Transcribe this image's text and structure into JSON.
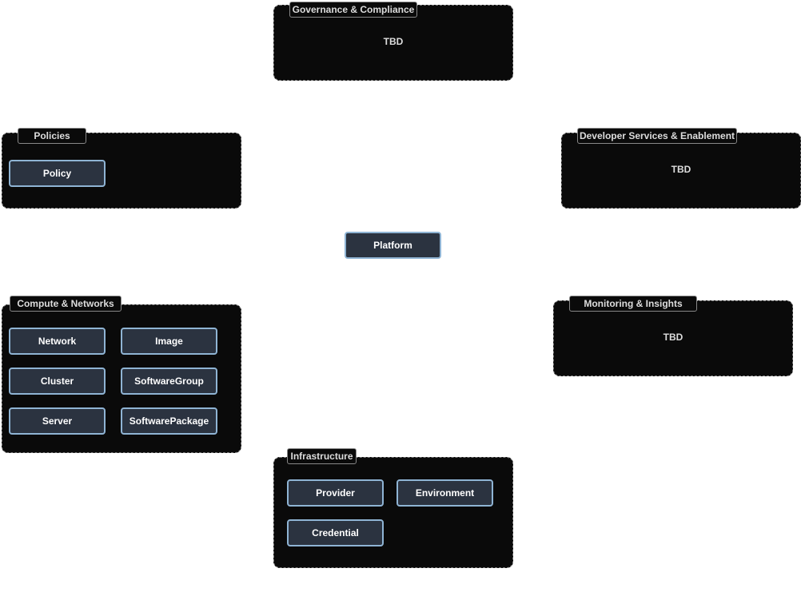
{
  "center": {
    "label": "Platform"
  },
  "groups": {
    "governance": {
      "title": "Governance & Compliance",
      "body": "TBD"
    },
    "policies": {
      "title": "Policies",
      "nodes": [
        "Policy"
      ]
    },
    "developer": {
      "title": "Developer Services & Enablement",
      "body": "TBD"
    },
    "compute": {
      "title": "Compute & Networks",
      "nodes": [
        "Network",
        "Image",
        "Cluster",
        "SoftwareGroup",
        "Server",
        "SoftwarePackage"
      ]
    },
    "monitoring": {
      "title": "Monitoring & Insights",
      "body": "TBD"
    },
    "infrastructure": {
      "title": "Infrastructure",
      "nodes": [
        "Provider",
        "Environment",
        "Credential"
      ]
    }
  },
  "colors": {
    "group_bg": "#0a0a0a",
    "node_bg": "#2b3340",
    "node_border": "#8fb4d4"
  }
}
